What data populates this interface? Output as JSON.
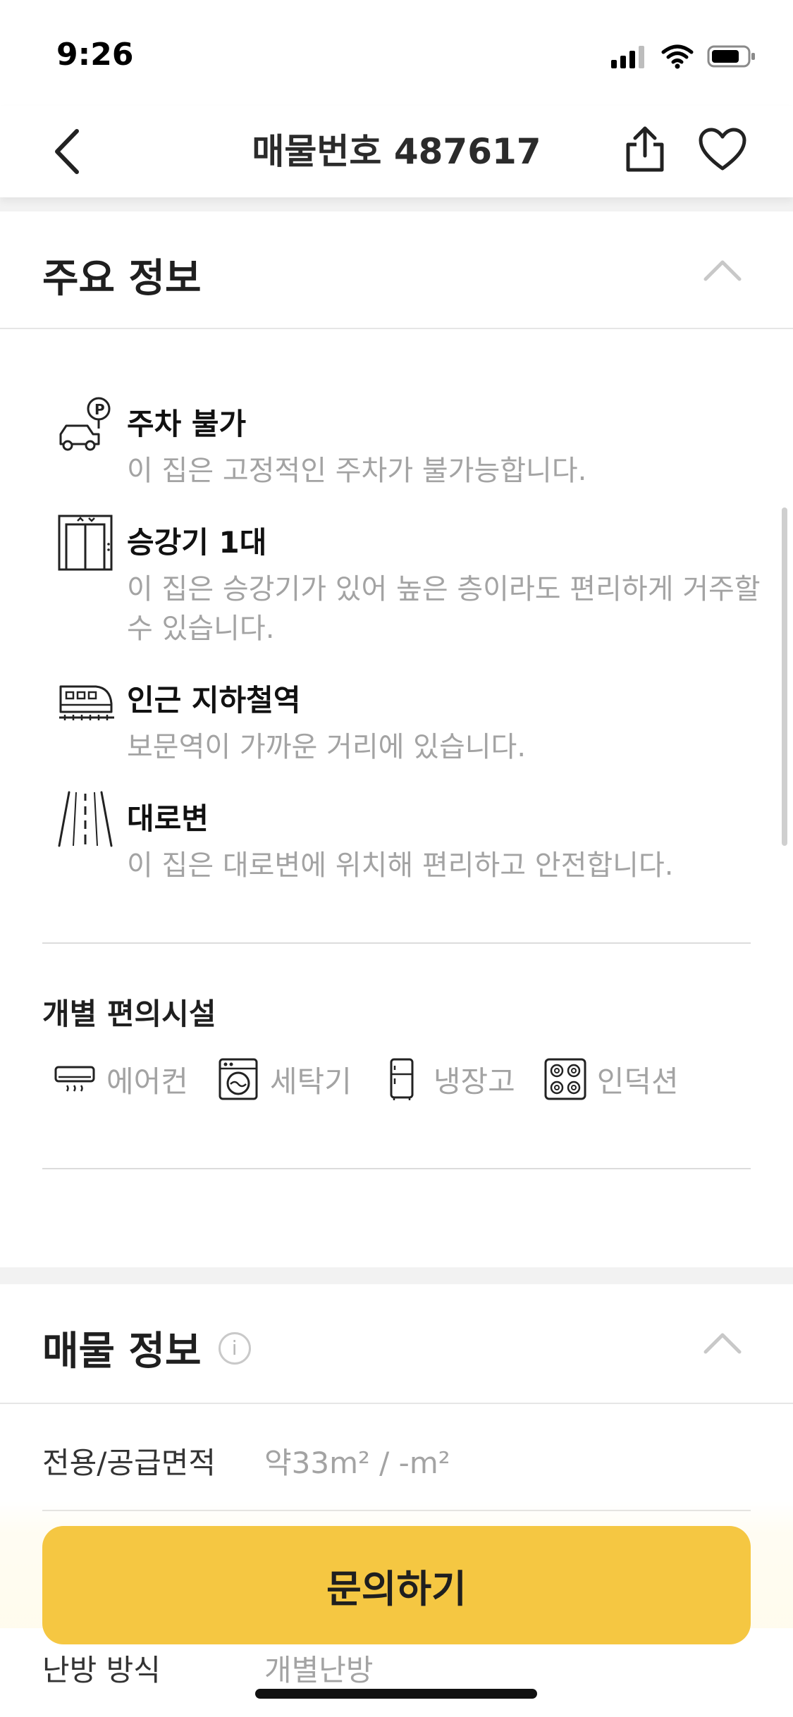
{
  "status_bar": {
    "time": "9:26"
  },
  "nav": {
    "title": "매물번호 487617",
    "back_icon": "chevron-left-icon",
    "share_icon": "share-icon",
    "favorite_icon": "heart-icon"
  },
  "main_info": {
    "title": "주요 정보",
    "features": [
      {
        "icon": "parking-icon",
        "title": "주차 불가",
        "description": "이 집은 고정적인 주차가 불가능합니다."
      },
      {
        "icon": "elevator-icon",
        "title": "승강기 1대",
        "description": "이 집은 승강기가 있어 높은 층이라도 편리하게 거주할 수 있습니다."
      },
      {
        "icon": "subway-icon",
        "title": "인근 지하철역",
        "description": "보문역이 가까운 거리에 있습니다."
      },
      {
        "icon": "road-icon",
        "title": "대로변",
        "description": "이 집은 대로변에 위치해 편리하고 안전합니다."
      }
    ],
    "amenities_title": "개별 편의시설",
    "amenities": [
      {
        "icon": "air-conditioner-icon",
        "label": "에어컨"
      },
      {
        "icon": "washing-machine-icon",
        "label": "세탁기"
      },
      {
        "icon": "refrigerator-icon",
        "label": "냉장고"
      },
      {
        "icon": "induction-icon",
        "label": "인덕션"
      }
    ]
  },
  "listing_info": {
    "title": "매물 정보",
    "info_icon_glyph": "i",
    "rows": [
      {
        "label": "전용/공급면적",
        "value": "약33m² / -m²"
      },
      {
        "label": "난방 방식",
        "value": "개별난방"
      }
    ]
  },
  "cta": {
    "label": "문의하기"
  },
  "colors": {
    "accent": "#f5c742",
    "muted_text": "#a3a3a3",
    "divider": "#dcdcdc"
  }
}
